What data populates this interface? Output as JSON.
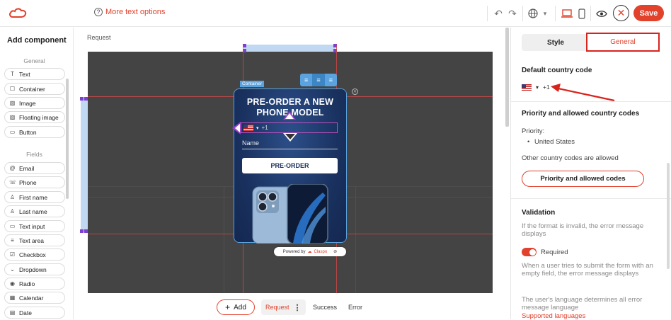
{
  "topbar": {
    "more_text": "More text options",
    "save_label": "Save"
  },
  "left_panel": {
    "title": "Add component",
    "general_label": "General",
    "general_items": [
      {
        "label": "Text",
        "icon": "text-icon"
      },
      {
        "label": "Container",
        "icon": "container-icon"
      },
      {
        "label": "Image",
        "icon": "image-icon"
      },
      {
        "label": "Floating image",
        "icon": "floating-image-icon"
      },
      {
        "label": "Button",
        "icon": "button-icon"
      }
    ],
    "fields_label": "Fields",
    "field_items": [
      {
        "label": "Email",
        "icon": "at-icon"
      },
      {
        "label": "Phone",
        "icon": "phone-icon"
      },
      {
        "label": "First name",
        "icon": "person-icon"
      },
      {
        "label": "Last name",
        "icon": "person-icon"
      },
      {
        "label": "Text input",
        "icon": "text-input-icon"
      },
      {
        "label": "Text area",
        "icon": "text-area-icon"
      },
      {
        "label": "Checkbox",
        "icon": "checkbox-icon"
      },
      {
        "label": "Dropdown",
        "icon": "dropdown-icon"
      },
      {
        "label": "Radio",
        "icon": "radio-icon"
      },
      {
        "label": "Calendar",
        "icon": "calendar-icon"
      },
      {
        "label": "Date",
        "icon": "date-icon"
      }
    ]
  },
  "canvas": {
    "page_label": "Request",
    "container_tag": "Container",
    "popup_title": "PRE-ORDER A NEW PHONE MODEL",
    "phone_code": "+1",
    "name_placeholder": "Name",
    "cta_label": "PRE-ORDER",
    "powered_by": "Powered by",
    "brand": "Claspo"
  },
  "bottom_bar": {
    "add_label": "Add",
    "tabs": [
      "Request",
      "Success",
      "Error"
    ]
  },
  "right_panel": {
    "tab_style": "Style",
    "tab_general": "General",
    "default_country_heading": "Default country code",
    "default_code": "+1",
    "priority_heading": "Priority and allowed country codes",
    "priority_label": "Priority:",
    "priority_country": "United States",
    "other_allowed": "Other country codes are allowed",
    "priority_button": "Priority and allowed codes",
    "validation_heading": "Validation",
    "validation_hint": "If the format is invalid, the error message displays",
    "required_label": "Required",
    "required_hint": "When a user tries to submit the form with an empty field, the error message displays",
    "language_hint": "The user's language determines all error message language",
    "supported_link": "Supported languages"
  },
  "colors": {
    "accent": "#e2412c",
    "canvas_bg": "#444444",
    "popup_bg": "#1e3a6b",
    "selection": "#5aa3e0"
  }
}
